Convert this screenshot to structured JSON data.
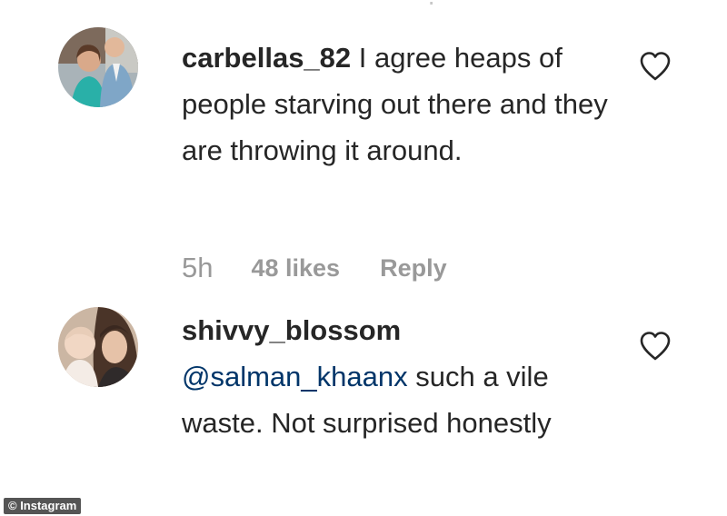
{
  "comments": [
    {
      "username": "carbellas_82",
      "text": " I agree heaps of people starving out there and they are throwing it around.",
      "time": "5h",
      "likes": "48 likes",
      "reply_label": "Reply"
    },
    {
      "username": "shivvy_blossom",
      "mention": "@salman_khaanx",
      "text": " such a vile waste. Not surprised honestly"
    }
  ],
  "credit": "© Instagram",
  "icons": {
    "like": "heart-outline-icon"
  },
  "colors": {
    "username": "#262626",
    "text": "#262626",
    "mention": "#003569",
    "meta": "#999999"
  }
}
